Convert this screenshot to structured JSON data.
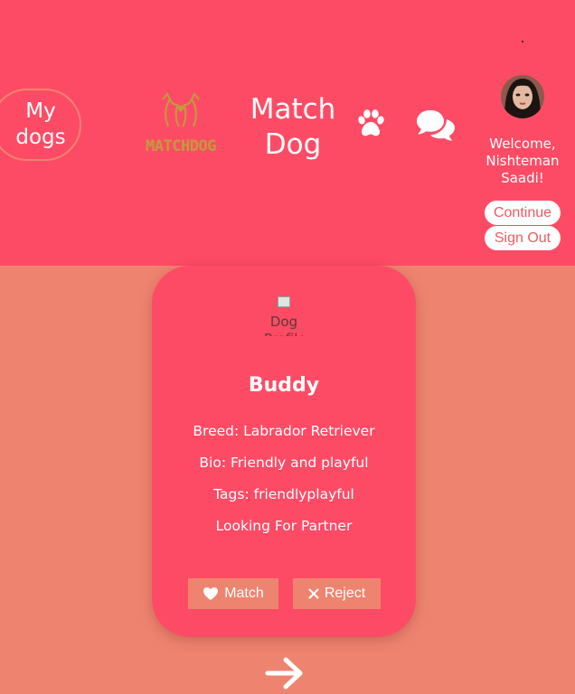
{
  "header": {
    "my_dogs_label": "My dogs",
    "logo_text": "MATCHDOG",
    "brand_line1": "Match",
    "brand_line2": "Dog",
    "welcome_text": "Welcome, Nishteman Saadi!",
    "continue_label": "Continue",
    "sign_out_label": "Sign Out",
    "icons": [
      "paw-icon",
      "chat-icon"
    ]
  },
  "card": {
    "image_alt": "Dog Profile",
    "name": "Buddy",
    "breed": "Breed: Labrador Retriever",
    "bio": "Bio: Friendly and playful",
    "tags": "Tags: friendlyplayful",
    "looking_for": "Looking For Partner",
    "match_label": "Match",
    "reject_label": "Reject"
  },
  "colors": {
    "header_bg": "#fe4b65",
    "page_bg": "#ee8470",
    "card_bg": "#fe4b65",
    "button_bg": "#ee8470",
    "pill_text": "#ee5b5e",
    "logo_gold": "#c39a3c"
  },
  "icons": {
    "next": "arrow-right-icon",
    "match": "heart-icon",
    "reject": "x-icon"
  }
}
